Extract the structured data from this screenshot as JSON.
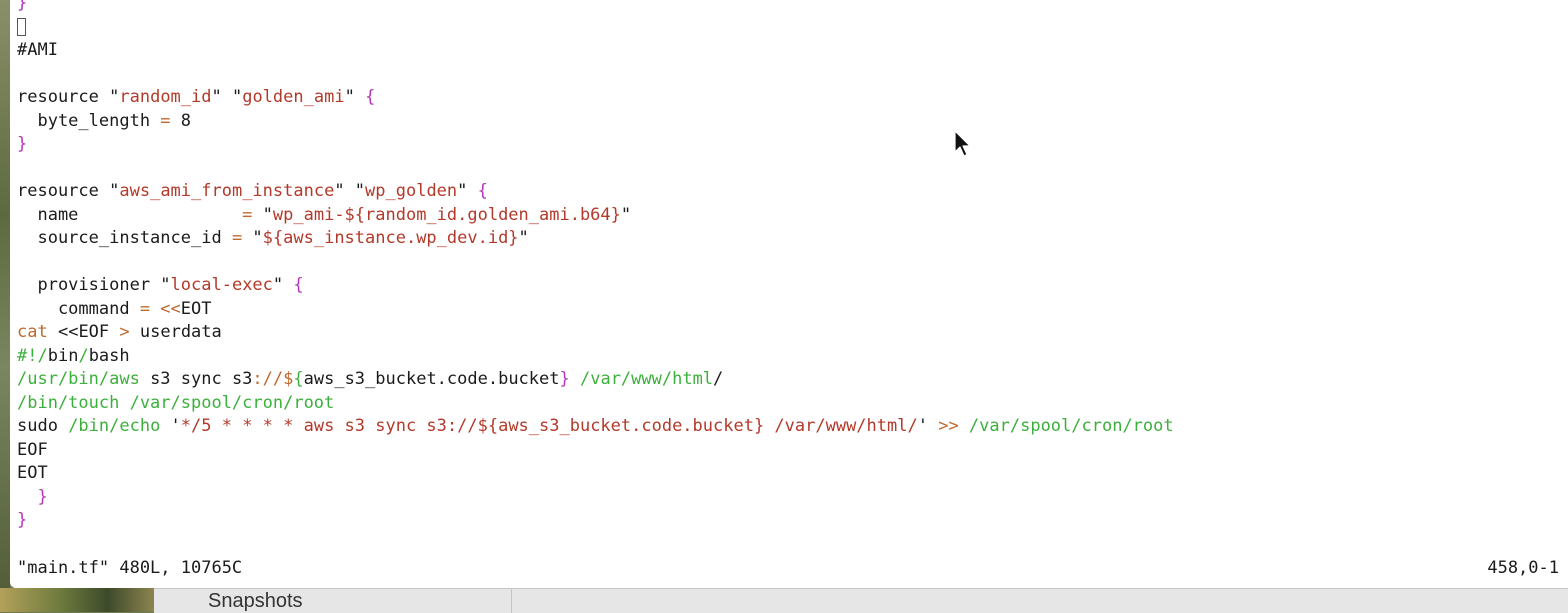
{
  "editor": {
    "lines": [
      [
        {
          "t": "}",
          "c": "brace"
        }
      ],
      [
        {
          "cursor": true
        }
      ],
      [
        {
          "t": "#AMI",
          "c": "plain"
        }
      ],
      [],
      [
        {
          "t": "resource ",
          "c": "kw"
        },
        {
          "t": "\"",
          "c": "plain"
        },
        {
          "t": "random_id",
          "c": "str"
        },
        {
          "t": "\" \"",
          "c": "plain"
        },
        {
          "t": "golden_ami",
          "c": "str"
        },
        {
          "t": "\" ",
          "c": "plain"
        },
        {
          "t": "{",
          "c": "brace"
        }
      ],
      [
        {
          "t": "  byte_length ",
          "c": "plain"
        },
        {
          "t": "=",
          "c": "op"
        },
        {
          "t": " 8",
          "c": "plain"
        }
      ],
      [
        {
          "t": "}",
          "c": "brace"
        }
      ],
      [],
      [
        {
          "t": "resource ",
          "c": "kw"
        },
        {
          "t": "\"",
          "c": "plain"
        },
        {
          "t": "aws_ami_from_instance",
          "c": "str"
        },
        {
          "t": "\" \"",
          "c": "plain"
        },
        {
          "t": "wp_golden",
          "c": "str"
        },
        {
          "t": "\" ",
          "c": "plain"
        },
        {
          "t": "{",
          "c": "brace"
        }
      ],
      [
        {
          "t": "  name                ",
          "c": "plain"
        },
        {
          "t": "=",
          "c": "op"
        },
        {
          "t": " \"",
          "c": "plain"
        },
        {
          "t": "wp_ami-${random_id.golden_ami.b64}",
          "c": "str"
        },
        {
          "t": "\"",
          "c": "plain"
        }
      ],
      [
        {
          "t": "  source_instance_id ",
          "c": "plain"
        },
        {
          "t": "=",
          "c": "op"
        },
        {
          "t": " \"",
          "c": "plain"
        },
        {
          "t": "${aws_instance.wp_dev.id}",
          "c": "str"
        },
        {
          "t": "\"",
          "c": "plain"
        }
      ],
      [],
      [
        {
          "t": "  provisioner ",
          "c": "plain"
        },
        {
          "t": "\"",
          "c": "plain"
        },
        {
          "t": "local-exec",
          "c": "str"
        },
        {
          "t": "\" ",
          "c": "plain"
        },
        {
          "t": "{",
          "c": "brace"
        }
      ],
      [
        {
          "t": "    command ",
          "c": "plain"
        },
        {
          "t": "= <<",
          "c": "op"
        },
        {
          "t": "EOT",
          "c": "plain"
        }
      ],
      [
        {
          "t": "cat ",
          "c": "op"
        },
        {
          "t": "<<",
          "c": "plain"
        },
        {
          "t": "EOF ",
          "c": "plain"
        },
        {
          "t": ">",
          "c": "op"
        },
        {
          "t": " userdata",
          "c": "plain"
        }
      ],
      [
        {
          "t": "#!/",
          "c": "path"
        },
        {
          "t": "bin",
          "c": "plain"
        },
        {
          "t": "/",
          "c": "path"
        },
        {
          "t": "bash",
          "c": "plain"
        }
      ],
      [
        {
          "t": "/usr/bin/aws",
          "c": "path"
        },
        {
          "t": " s3 sync s3",
          "c": "plain"
        },
        {
          "t": "://$",
          "c": "op"
        },
        {
          "t": "{",
          "c": "path"
        },
        {
          "t": "aws_s3_bucket.code.bucket",
          "c": "plain"
        },
        {
          "t": "}",
          "c": "brace"
        },
        {
          "t": " /var/www/html",
          "c": "path"
        },
        {
          "t": "/",
          "c": "plain"
        }
      ],
      [
        {
          "t": "/bin/touch /var/spool/cron/root",
          "c": "path"
        }
      ],
      [
        {
          "t": "sudo ",
          "c": "plain"
        },
        {
          "t": "/bin/echo",
          "c": "path"
        },
        {
          "t": " '",
          "c": "plain"
        },
        {
          "t": "*/5 * * * * aws s3 sync s3://${aws_s3_bucket.code.bucket} /var/www/html/",
          "c": "str"
        },
        {
          "t": "' ",
          "c": "plain"
        },
        {
          "t": ">>",
          "c": "op"
        },
        {
          "t": " /var/spool/cron/root",
          "c": "path"
        }
      ],
      [
        {
          "t": "EOF",
          "c": "plain"
        }
      ],
      [
        {
          "t": "EOT",
          "c": "plain"
        }
      ],
      [
        {
          "t": "  }",
          "c": "brace"
        }
      ],
      [
        {
          "t": "}",
          "c": "brace"
        }
      ]
    ]
  },
  "status": {
    "file_info": "\"main.tf\" 480L, 10765C",
    "position": "458,0-1"
  },
  "background_window": {
    "label": "Snapshots"
  }
}
